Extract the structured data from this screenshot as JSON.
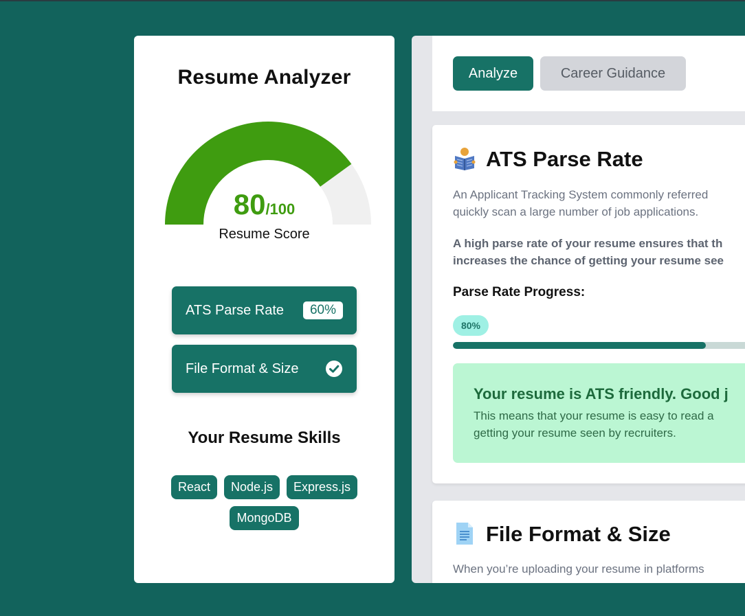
{
  "app": {
    "title": "Resume Analyzer"
  },
  "score": {
    "value": "80",
    "max": "/100",
    "label": "Resume Score",
    "fraction": 0.8,
    "color": "#3f9c10",
    "track_color": "#f0f0f0"
  },
  "sidebar": {
    "ats_label": "ATS Parse Rate",
    "ats_value": "60%",
    "file_label": "File Format & Size",
    "file_icon": "check-circle-icon"
  },
  "skills": {
    "title": "Your Resume Skills",
    "items": [
      "React",
      "Node.js",
      "Express.js",
      "MongoDB"
    ]
  },
  "tabs": {
    "analyze": "Analyze",
    "career": "Career Guidance"
  },
  "ats_card": {
    "icon": "person-reading-icon",
    "title": "ATS Parse Rate",
    "para1_line1": "An Applicant Tracking System commonly referred",
    "para1_line2": "quickly scan a large number of job applications.",
    "para2_line1": "A high parse rate of your resume ensures that th",
    "para2_line2": "increases the chance of getting your resume see",
    "progress_label": "Parse Rate Progress:",
    "progress_value": "80%",
    "progress_fraction": 0.8,
    "success_title": "Your resume is ATS friendly. Good j",
    "success_line1": "This means that your resume is easy to read a",
    "success_line2": "getting your resume seen by recruiters."
  },
  "file_card": {
    "icon": "document-icon",
    "title": "File Format & Size",
    "para": "When you’re uploading your resume in platforms"
  },
  "colors": {
    "background": "#12635c",
    "accent": "#177266",
    "success_bg": "#bbf6d3"
  }
}
